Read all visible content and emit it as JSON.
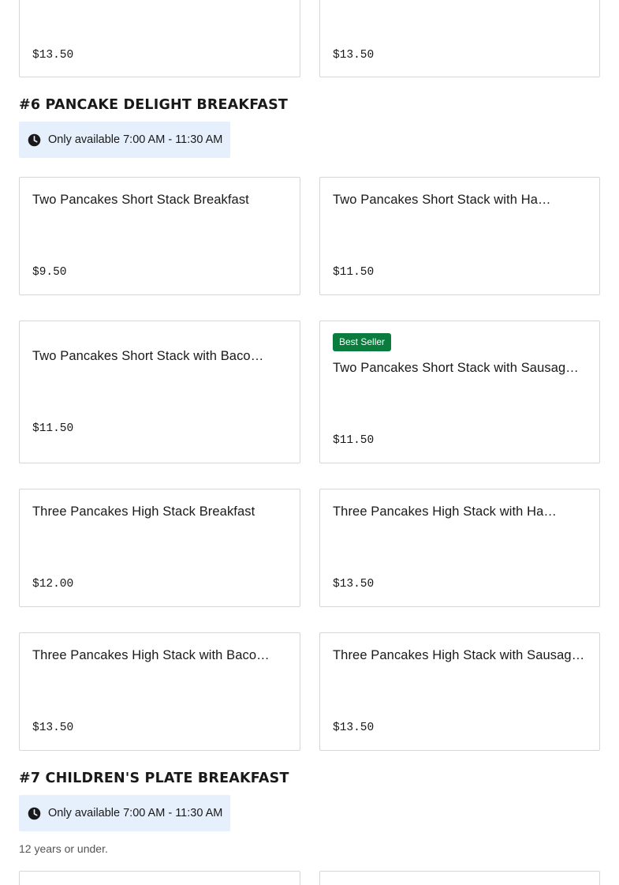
{
  "top_row": {
    "left_price": "$13.50",
    "right_price": "$13.50"
  },
  "sections": [
    {
      "title": "#6 Pancake Delight Breakfast",
      "availability": "Only available 7:00 AM - 11:30 AM",
      "items": [
        {
          "name": "Two Pancakes Short Stack Breakfast",
          "price": "$9.50"
        },
        {
          "name": "Two Pancakes Short Stack with Ham Breakfast",
          "price": "$11.50"
        },
        {
          "name": "Two Pancakes Short Stack with Bacon Breakfast",
          "price": "$11.50"
        },
        {
          "name": "Two Pancakes Short Stack with Sausage Breakfast",
          "price": "$11.50",
          "badge": "Best Seller"
        },
        {
          "name": "Three Pancakes High Stack Breakfast",
          "price": "$12.00"
        },
        {
          "name": "Three Pancakes High Stack with Ham Breakfast",
          "price": "$13.50"
        },
        {
          "name": "Three Pancakes High Stack with Bacon Breakfast",
          "price": "$13.50"
        },
        {
          "name": "Three Pancakes High Stack with Sausage Breakfast",
          "price": "$13.50"
        }
      ]
    },
    {
      "title": "#7 Children's Plate Breakfast",
      "availability": "Only available 7:00 AM - 11:30 AM",
      "description": "12 years or under."
    }
  ],
  "icons": {
    "clock": "clock-icon"
  },
  "colors": {
    "badge_bg": "#0a7c3e",
    "availability_bg": "#e6effc"
  }
}
